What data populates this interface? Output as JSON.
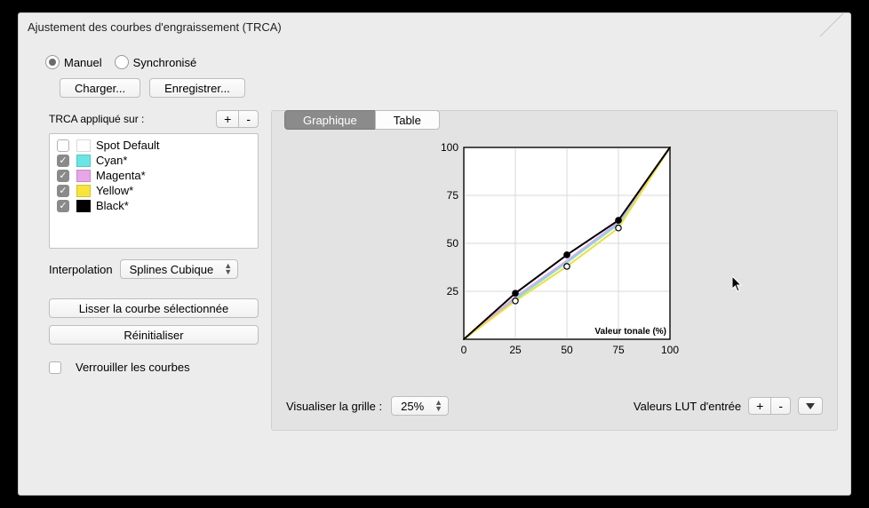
{
  "window_title": "Ajustement des courbes d'engraissement (TRCA)",
  "mode": {
    "manual_label": "Manuel",
    "sync_label": "Synchronisé",
    "selected": "manual"
  },
  "buttons": {
    "load": "Charger...",
    "save": "Enregistrer...",
    "smooth": "Lisser la courbe sélectionnée",
    "reset": "Réinitialiser"
  },
  "applied_on": {
    "label": "TRCA appliqué sur :",
    "plus": "+",
    "minus": "-",
    "items": [
      {
        "label": "Spot Default",
        "checked": false,
        "color": "#ffffff"
      },
      {
        "label": "Cyan*",
        "checked": true,
        "color": "#68e6e6"
      },
      {
        "label": "Magenta*",
        "checked": true,
        "color": "#e8a6e8"
      },
      {
        "label": "Yellow*",
        "checked": true,
        "color": "#f9e43a"
      },
      {
        "label": "Black*",
        "checked": true,
        "color": "#000000"
      }
    ]
  },
  "interpolation": {
    "label": "Interpolation",
    "value": "Splines Cubique"
  },
  "lock_curves": {
    "label": "Verrouiller les courbes",
    "checked": false
  },
  "tabs": {
    "graph": "Graphique",
    "table": "Table",
    "active": "graph"
  },
  "grid": {
    "label": "Visualiser la grille :",
    "value": "25%"
  },
  "lut": {
    "label": "Valeurs LUT d'entrée",
    "plus": "+",
    "minus": "-"
  },
  "chart_data": {
    "type": "line",
    "title": "",
    "xlabel": "Valeur tonale (%)",
    "ylabel": "",
    "xlim": [
      0,
      100
    ],
    "ylim": [
      0,
      100
    ],
    "x_ticks": [
      0,
      25,
      50,
      75,
      100
    ],
    "y_ticks": [
      0,
      25,
      50,
      75,
      100
    ],
    "x": [
      0,
      25,
      50,
      75,
      100
    ],
    "series": [
      {
        "name": "Cyan",
        "color": "#68e6e6",
        "values": [
          0,
          21,
          40,
          60,
          100
        ]
      },
      {
        "name": "Magenta",
        "color": "#e8a6e8",
        "values": [
          0,
          22,
          41,
          61,
          100
        ]
      },
      {
        "name": "Yellow",
        "color": "#f3df2f",
        "values": [
          0,
          20,
          38,
          58,
          100
        ]
      },
      {
        "name": "Black",
        "color": "#000000",
        "values": [
          0,
          24,
          44,
          62,
          100
        ]
      }
    ],
    "markers": [
      {
        "x": 25,
        "y": 24
      },
      {
        "x": 50,
        "y": 44
      },
      {
        "x": 75,
        "y": 62
      },
      {
        "x": 25,
        "y": 20
      },
      {
        "x": 50,
        "y": 38
      },
      {
        "x": 75,
        "y": 58
      }
    ]
  }
}
